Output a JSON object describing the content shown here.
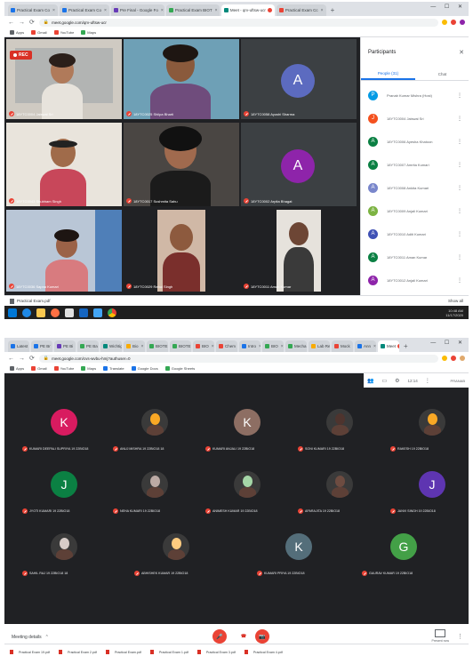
{
  "shot1": {
    "tabs": [
      {
        "label": "Practical Exam Co",
        "color": "#1a73e8"
      },
      {
        "label": "Practical Exam Co",
        "color": "#1a73e8"
      },
      {
        "label": "Pre Final - Google Fo",
        "color": "#673ab7"
      },
      {
        "label": "Practical Exam BIOT",
        "color": "#34a853"
      },
      {
        "label": "Meet - qrv-uftsw-ucr",
        "color": "#00897b",
        "active": true,
        "recording": true
      },
      {
        "label": "Practical Exam Cc",
        "color": "#ea4335"
      }
    ],
    "url": "meet.google.com/qrv-uftsw-ucr",
    "bookmarks": [
      {
        "label": "Apps",
        "color": "#5f6368"
      },
      {
        "label": "Gmail",
        "color": "#ea4335"
      },
      {
        "label": "YouTube",
        "color": "#ea4335"
      },
      {
        "label": "Maps",
        "color": "#34a853"
      }
    ],
    "rec_label": "REC",
    "tiles": [
      {
        "name": "18YTC0004 Jaiswal Sri",
        "kind": "photo"
      },
      {
        "name": "18YTC0025 Shilpa Bharti",
        "kind": "photo"
      },
      {
        "name": "18YTC0058 Ayushi Sharma",
        "kind": "avatar",
        "letter": "A",
        "color": "#5c6bc0"
      },
      {
        "name": "18YTC0043 Shubham Singh",
        "kind": "photo"
      },
      {
        "name": "18YTC0017 Sushmita Sahu",
        "kind": "photo"
      },
      {
        "name": "18YTC0002 Arpita Bhagat",
        "kind": "avatar",
        "letter": "A",
        "color": "#8e24aa"
      },
      {
        "name": "18YTC0036 Sapna Kumari",
        "kind": "photo"
      },
      {
        "name": "18YTC0029 Rahul Singh",
        "kind": "photo"
      },
      {
        "name": "18YTC0011 Aman Kumar",
        "kind": "photo"
      }
    ],
    "panel": {
      "title": "Participants",
      "tab_people": "People (31)",
      "tab_chat": "Chat",
      "participants": [
        {
          "name": "Pranab Kumar Mishra (Host)",
          "letter": "P",
          "color": "#039be5"
        },
        {
          "name": "18YTC0004 Jaiswal Sri",
          "letter": "J",
          "color": "#f4511e"
        },
        {
          "name": "18YTC0006 Ayesha Khatoon",
          "letter": "A",
          "color": "#0b8043"
        },
        {
          "name": "18YTC0007 Amrita Kumari",
          "letter": "A",
          "color": "#0b8043"
        },
        {
          "name": "18YTC0008 Ankita Kumari",
          "letter": "A",
          "color": "#7986cb"
        },
        {
          "name": "18YTC0009 Anjali Kumari",
          "letter": "A",
          "color": "#7cb342"
        },
        {
          "name": "18YTC0010 Aditi Kumari",
          "letter": "A",
          "color": "#3f51b5"
        },
        {
          "name": "18YTC0011 Aman Kumar",
          "letter": "A",
          "color": "#0b8043"
        },
        {
          "name": "18YTC0012 Anjali Kumari",
          "letter": "A",
          "color": "#8e24aa"
        },
        {
          "name": "18YTC0013 Anupriya Singh",
          "letter": "A",
          "color": "#7986cb"
        }
      ]
    },
    "download": "Practical Exam.pdf",
    "show_all": "Show all",
    "tray_time": "10:48 AM",
    "tray_date": "11/17/2020"
  },
  "shot2": {
    "tabs": [
      {
        "label": "Latest",
        "color": "#1a73e8"
      },
      {
        "label": "PE Br",
        "color": "#1a73e8"
      },
      {
        "label": "PE Bi",
        "color": "#673ab7"
      },
      {
        "label": "PE Ba",
        "color": "#34a853"
      },
      {
        "label": "Wichtig",
        "color": "#00897b"
      },
      {
        "label": "Bio",
        "color": "#f9ab00"
      },
      {
        "label": "BIOTE",
        "color": "#34a853"
      },
      {
        "label": "BIOTE",
        "color": "#34a853"
      },
      {
        "label": "BIO",
        "color": "#ea4335"
      },
      {
        "label": "Chem",
        "color": "#ea4335"
      },
      {
        "label": "Intro",
        "color": "#1a73e8"
      },
      {
        "label": "BIO",
        "color": "#34a853"
      },
      {
        "label": "Mecha",
        "color": "#34a853"
      },
      {
        "label": "Lab Rep",
        "color": "#f9ab00"
      },
      {
        "label": "Mock",
        "color": "#ea4335"
      },
      {
        "label": "Ann",
        "color": "#1a73e8"
      },
      {
        "label": "Meet",
        "color": "#00897b",
        "active": true,
        "recording": true
      }
    ],
    "url": "meet.google.com/cvs-wvbu-hmj?authuser=0",
    "bookmarks": [
      {
        "label": "Apps",
        "color": "#5f6368"
      },
      {
        "label": "Gmail",
        "color": "#ea4335"
      },
      {
        "label": "YouTube",
        "color": "#ea4335"
      },
      {
        "label": "Maps",
        "color": "#34a853"
      },
      {
        "label": "Translate",
        "color": "#1a73e8"
      },
      {
        "label": "Google Docs",
        "color": "#1a73e8"
      },
      {
        "label": "Google Sheets",
        "color": "#34a853"
      }
    ],
    "toolstrip_time": "12:14",
    "toolstrip_user": "PRANAB",
    "grid": [
      {
        "name": "KUMARI DEEPALI SUPRIYA 19 22BIO18",
        "kind": "avatar",
        "letter": "K",
        "color": "#d81b60"
      },
      {
        "name": "ANUJ MISHRA 19 22BIO18 18",
        "kind": "photo",
        "color": "#f9a825"
      },
      {
        "name": "KUMARI ANJALI 19 22BIO18",
        "kind": "avatar",
        "letter": "K",
        "color": "#8d6e63"
      },
      {
        "name": "SONI KUMARI 19 22BIO18",
        "kind": "photo",
        "color": "#4e342e"
      },
      {
        "name": "RAKESH 19 22BIO18",
        "kind": "photo",
        "color": "#f9a825"
      },
      {
        "name": "JYOTI KUMARI 19 22BIO18",
        "kind": "avatar",
        "letter": "J",
        "color": "#0b8043"
      },
      {
        "name": "NEHA KUMARI 19 22BIO18",
        "kind": "photo",
        "color": "#bcaaa4"
      },
      {
        "name": "ANIMESH KUMAR 19 22BIO18",
        "kind": "photo",
        "color": "#a5d6a7"
      },
      {
        "name": "APARAJITA 19 22BIO18",
        "kind": "photo",
        "color": "#6d4c41"
      },
      {
        "name": "JANVI SINGH 19 22BIO18",
        "kind": "avatar",
        "letter": "J",
        "color": "#5e35b1"
      },
      {
        "name": "SAHIL RAJ 19 22BIO18 18",
        "kind": "photo",
        "color": "#d7ccc8"
      },
      {
        "name": "ABHISHEK KUMAR 19 22BIO18",
        "kind": "photo",
        "color": "#ffcc80"
      },
      {
        "name": "KUMARI PRIYA 19 22BIO18",
        "kind": "avatar",
        "letter": "K",
        "color": "#546e7a"
      },
      {
        "name": "GAURAV KUMAR 19 22BIO18",
        "kind": "avatar",
        "letter": "G",
        "color": "#43a047"
      }
    ],
    "meeting_details": "Meeting details",
    "present_label": "Present now",
    "downloads": [
      "Practical Exam 19.pdf",
      "Practical Exam 2.pdf",
      "Practical Exam.pdf",
      "Practical Exam 1.pdf",
      "Practical Exam 3.pdf",
      "Practical Exam 4.pdf"
    ]
  }
}
